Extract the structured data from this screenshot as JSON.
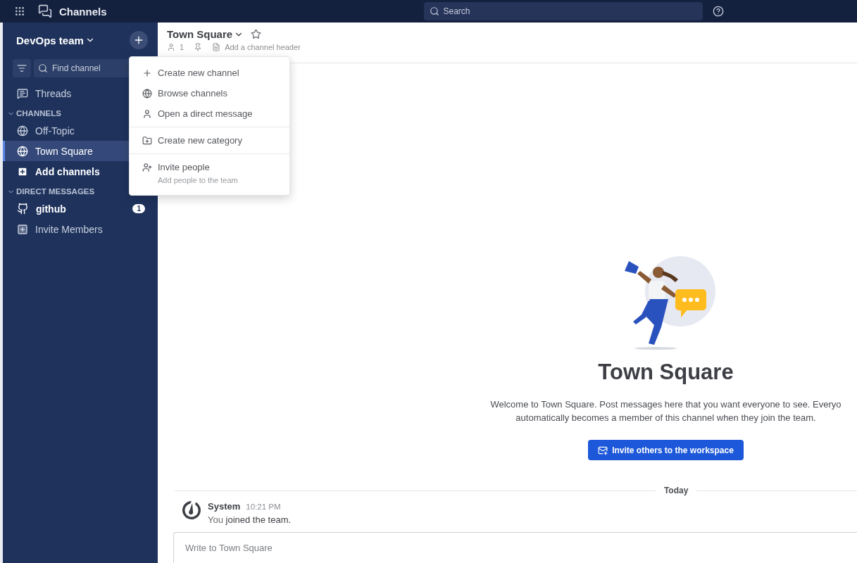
{
  "top_bar": {
    "app_title": "Channels",
    "search": {
      "placeholder": "Search"
    }
  },
  "sidebar": {
    "team_name": "DevOps team",
    "find_channel": {
      "placeholder": "Find channel"
    },
    "threads": "Threads",
    "sections": [
      {
        "title": "CHANNELS",
        "expanded": true,
        "items": [
          {
            "kind": "channel",
            "label": "Off-Topic",
            "selected": false,
            "unread": false
          },
          {
            "kind": "channel",
            "label": "Town Square",
            "selected": true,
            "unread": false
          },
          {
            "kind": "add",
            "label": "Add channels",
            "selected": false,
            "unread": true
          }
        ]
      },
      {
        "title": "DIRECT MESSAGES",
        "expanded": true,
        "items": [
          {
            "kind": "dm",
            "label": "github",
            "selected": false,
            "unread": true,
            "badge": "1"
          },
          {
            "kind": "invite",
            "label": "Invite Members",
            "selected": false,
            "unread": false
          }
        ]
      }
    ]
  },
  "channel_header": {
    "name": "Town Square",
    "favorite": false,
    "member_count": "1",
    "header_placeholder": "Add a channel header"
  },
  "add_menu": {
    "groups": [
      [
        {
          "kind": "plus",
          "label": "Create new channel"
        },
        {
          "kind": "globe",
          "label": "Browse channels"
        },
        {
          "kind": "user",
          "label": "Open a direct message"
        }
      ],
      [
        {
          "kind": "folder",
          "label": "Create new category"
        }
      ],
      [
        {
          "kind": "invite",
          "label": "Invite people",
          "description": "Add people to the team"
        }
      ]
    ]
  },
  "intro": {
    "title": "Town Square",
    "lines": [
      "Welcome to Town Square. Post messages here that you want everyone to see. Everyo",
      "automatically becomes a member of this channel when they join the team."
    ],
    "button": "Invite others to the workspace"
  },
  "date_separator": "Today",
  "posts": [
    {
      "author": "System",
      "time": "10:21 PM",
      "text": "You **joined the team.**"
    }
  ],
  "composer": {
    "placeholder": "Write to Town Square"
  }
}
